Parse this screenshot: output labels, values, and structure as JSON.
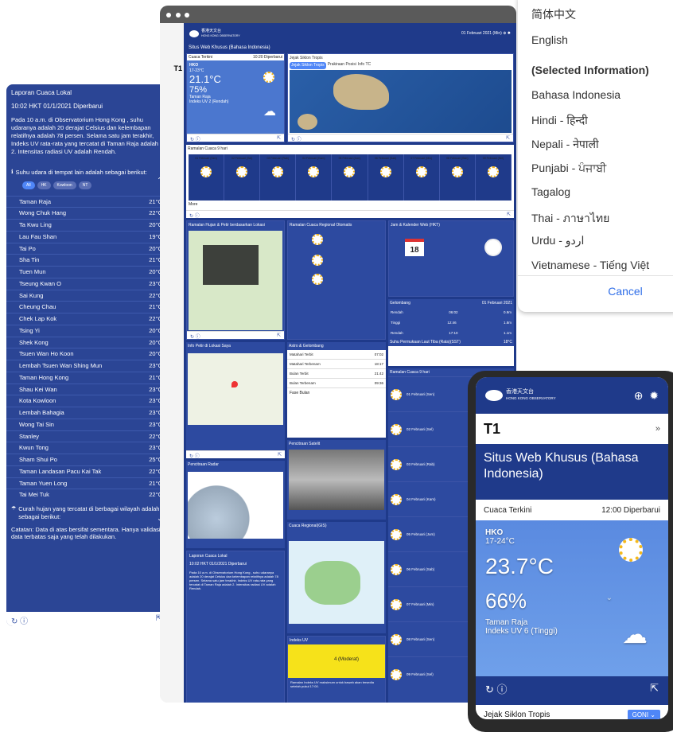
{
  "left": {
    "title": "Laporan Cuaca Lokal",
    "time": "10:02 HKT 01/1/2021 Diperbarui",
    "para": "Pada 10 a.m. di Observatorium Hong Kong , suhu udaranya adalah 20 derajat Celsius dan kelembapan relatifnya adalah 78 persen. Selama satu jam terakhir, Indeks UV rata-rata yang tercatat di Taman Raja adalah 2. Intensitas radiasi UV adalah Rendah.",
    "temp_head": "Suhu udara di tempat lain adalah sebagai berikut:",
    "filters": [
      "All",
      "HK",
      "Kowloon",
      "NT"
    ],
    "rows": [
      [
        "Taman Raja",
        "21°C"
      ],
      [
        "Wong Chuk Hang",
        "22°C"
      ],
      [
        "Ta Kwu Ling",
        "20°C"
      ],
      [
        "Lau Fau Shan",
        "19°C"
      ],
      [
        "Tai Po",
        "20°C"
      ],
      [
        "Sha Tin",
        "21°C"
      ],
      [
        "Tuen Mun",
        "20°C"
      ],
      [
        "Tseung Kwan O",
        "23°C"
      ],
      [
        "Sai Kung",
        "22°C"
      ],
      [
        "Cheung Chau",
        "21°C"
      ],
      [
        "Chek Lap Kok",
        "22°C"
      ],
      [
        "Tsing Yi",
        "20°C"
      ],
      [
        "Shek Kong",
        "20°C"
      ],
      [
        "Tsuen Wan Ho Koon",
        "20°C"
      ],
      [
        "Lembah Tsuen Wan Shing Mun",
        "23°C"
      ],
      [
        "Taman Hong Kong",
        "21°C"
      ],
      [
        "Shau Kei Wan",
        "23°C"
      ],
      [
        "Kota Kowloon",
        "23°C"
      ],
      [
        "Lembah Bahagia",
        "23°C"
      ],
      [
        "Wong Tai Sin",
        "23°C"
      ],
      [
        "Stanley",
        "22°C"
      ],
      [
        "Kwun Tong",
        "23°C"
      ],
      [
        "Sham Shui Po",
        "25°C"
      ],
      [
        "Taman Landasan Pacu Kai Tak",
        "22°C"
      ],
      [
        "Taman Yuen Long",
        "21°C"
      ],
      [
        "Tai Mei Tuk",
        "22°C"
      ]
    ],
    "rain": "Curah hujan yang tercatat di berbagai wilayah adalah sebagai berikut:",
    "note": "Catatan: Data di atas bersifat sementara. Hanya validasi data terbatas saja yang telah dilakukan."
  },
  "lang": {
    "items": [
      "简体中文",
      "English"
    ],
    "selected": "(Selected Information)",
    "others": [
      "Bahasa Indonesia",
      "Hindi - हिन्दी",
      "Nepali - नेपाली",
      "Punjabi - ਪੰਜਾਬੀ",
      "Tagalog",
      "Thai - ภาษาไทย",
      "Urdu - اردو",
      "Vietnamese - Tiếng Việt"
    ],
    "cancel": "Cancel"
  },
  "desk": {
    "logo_cn": "香港天文台",
    "logo_en": "HONG KONG OBSERVATORY",
    "date": "01 Februari 2021 (Min)",
    "title": "Situs Web Khusus (Bahasa Indonesia)",
    "t1": "T1",
    "cur": {
      "label": "Cuaca Terkini",
      "upd": "10:20 Diperbarui",
      "station": "HKO",
      "range": "17-23°C",
      "temp": "21.1°C",
      "hum": "75%",
      "place": "Taman Raja",
      "uv": "Indeks UV 2 (Rendah)"
    },
    "cyclone": {
      "title": "Jejak Siklon Tropis",
      "tabs": [
        "Jejak Siklon Tropis",
        "Prakiraan Posisi",
        "Info TC"
      ]
    },
    "fc_title": "Ramalan Cuaca 9 hari",
    "fc_days": [
      "01 Februari (Sen)",
      "02 Februari (Sel)",
      "03 Februari (Rab)",
      "04 Februari (Kam)",
      "05 Februari (Jum)",
      "06 Februari (Sab)",
      "07 Februari (Min)",
      "08 Februari (Sen)",
      "09 Februari (Sel)"
    ],
    "more": "More",
    "rain_title": "Ramalan Hujan & Petir berdasarkan Lokasi",
    "region_title": "Ramalan Cuaca Regional Otomatis",
    "cal_title": "Jam & Kalender Web (HKT)",
    "cal_day": "18",
    "tide_title": "Gelombang",
    "tide_date": "01 Februari 2021",
    "tides": [
      [
        "Rendah",
        "06:02",
        "0.9m"
      ],
      [
        "Tinggi",
        "12:46",
        "1.8m"
      ],
      [
        "Rendah",
        "17:10",
        "1.1m"
      ]
    ],
    "sst": "Suhu Permukaan Laut Tiba (Rata)(SST)",
    "sst_v": "18°C",
    "loc_title": "Info Petir di Lokasi Saya",
    "astro_title": "Astro & Gelombang",
    "astro": [
      [
        "Matahari Terbit",
        "07:02"
      ],
      [
        "Matahari Terbenam",
        "18:17"
      ],
      [
        "Bulan Terbit",
        "21:42"
      ],
      [
        "Bulan Terbenam",
        "09:36"
      ]
    ],
    "fase": "Fase Bulan",
    "radar_title": "Pencitraan Radar",
    "sat_title": "Pencitraan Satelit",
    "gis_title": "Cuaca Regional(GIS)",
    "uv_title": "Indeks UV",
    "uv_val": "4 (Moderat)",
    "uv_note": "Ramalan Indeks UV maksimum untuk bawah akan tersedia setelah pukul 17:00.",
    "lap_title": "Laporan Cuaca Lokal",
    "lap_time": "10:02 HKT 01/1/2021 Diperbarui"
  },
  "mob": {
    "logo_cn": "香港天文台",
    "logo_en": "HONG KONG OBSERVATORY",
    "t1": "T1",
    "title": "Situs Web Khusus (Bahasa Indonesia)",
    "cur": "Cuaca Terkini",
    "upd": "12:00 Diperbarui",
    "station": "HKO",
    "range": "17-24°C",
    "temp": "23.7°C",
    "hum": "66%",
    "place": "Taman Raja",
    "uv": "Indeks UV 6 (Tinggi)",
    "next": "Jejak Siklon Tropis",
    "goni": "GONI"
  }
}
